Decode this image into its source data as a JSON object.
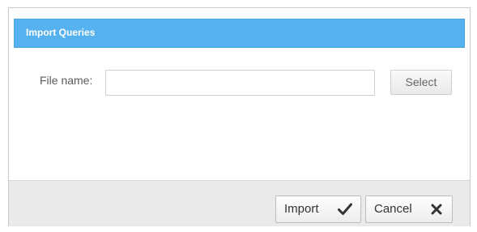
{
  "dialog": {
    "title": "Import Queries"
  },
  "form": {
    "file_label": "File name:",
    "file_value": "",
    "file_placeholder": "",
    "select_label": "Select"
  },
  "footer": {
    "import_label": "Import",
    "import_icon": "checkmark-icon",
    "cancel_label": "Cancel",
    "cancel_icon": "close-icon"
  },
  "colors": {
    "titlebar": "#56b2ee",
    "footer": "#eaeaea"
  }
}
